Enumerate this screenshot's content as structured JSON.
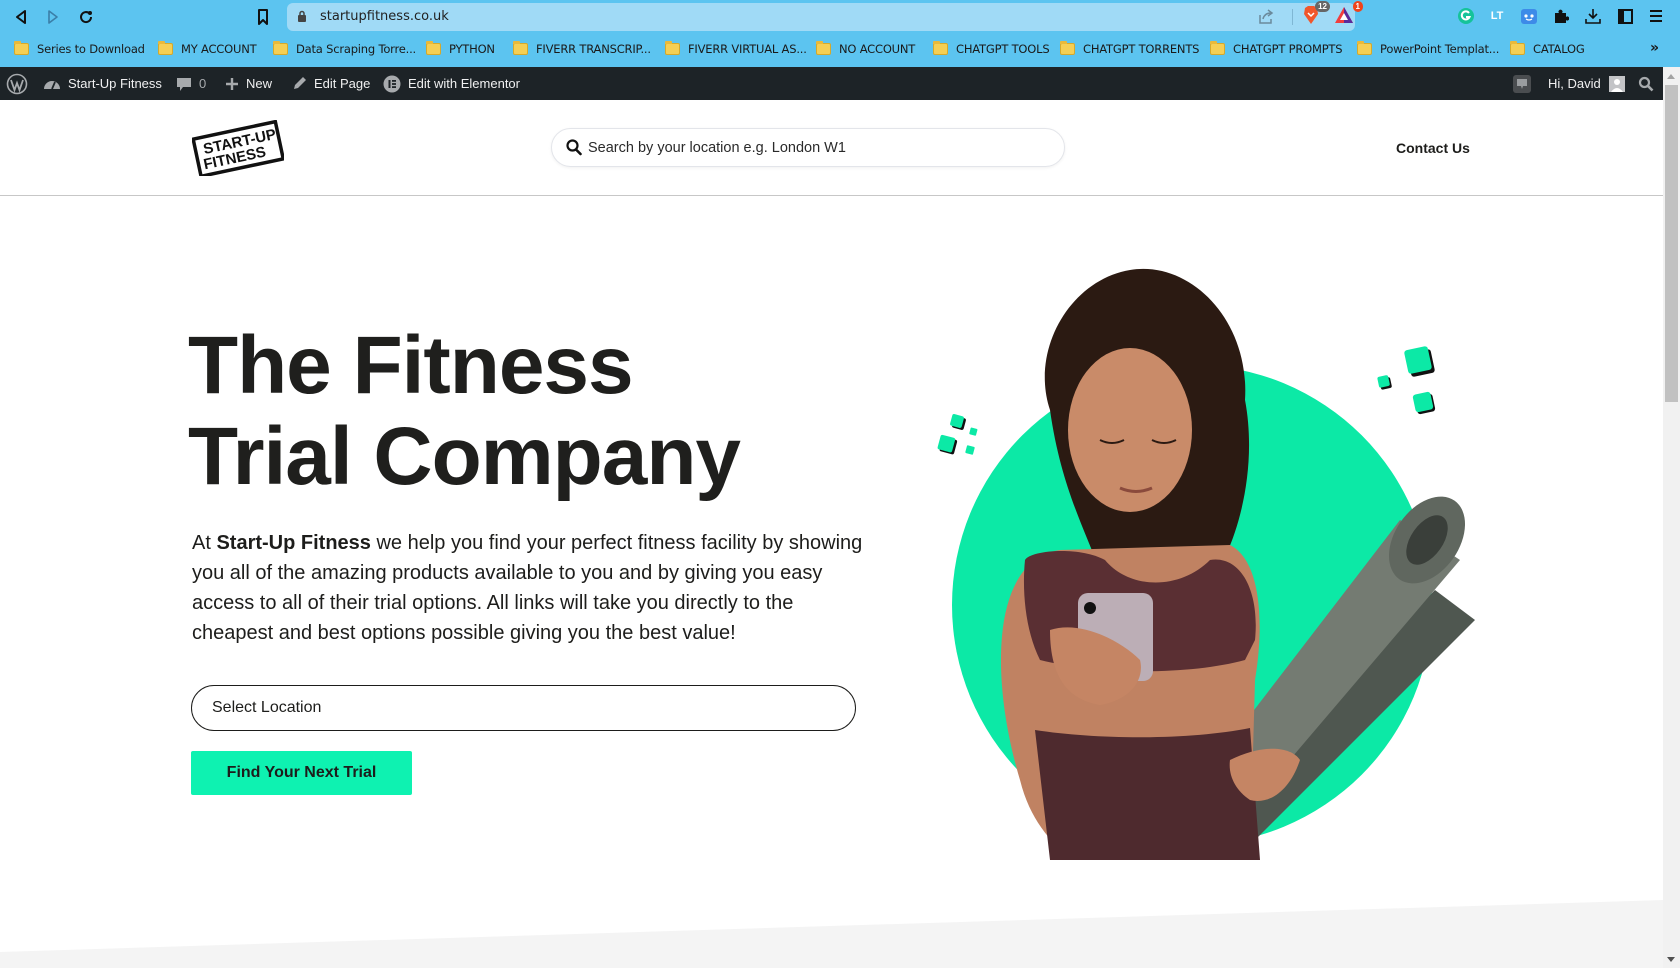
{
  "browser": {
    "url": "startupfitness.co.uk",
    "extensions": {
      "brave_shields_count": "12",
      "brave_rewards_count": "1",
      "lt_label": "LT"
    },
    "bookmarks": [
      "Series to Download",
      "MY ACCOUNT",
      "Data Scraping Torre...",
      "PYTHON",
      "FIVERR TRANSCRIP...",
      "FIVERR VIRTUAL AS...",
      "NO ACCOUNT",
      "CHATGPT TOOLS",
      "CHATGPT TORRENTS",
      "CHATGPT PROMPTS",
      "PowerPoint Templat...",
      "CATALOG"
    ],
    "bookmarks_overflow": "»"
  },
  "admin_bar": {
    "site_name": "Start-Up Fitness",
    "comments_count": "0",
    "new_label": "New",
    "edit_page_label": "Edit Page",
    "elementor_label": "Edit with Elementor",
    "greeting": "Hi, David"
  },
  "header": {
    "logo_line1": "START-UP",
    "logo_line2": "FITNESS",
    "search_placeholder": "Search by your location e.g. London W1",
    "contact_label": "Contact Us"
  },
  "hero": {
    "title_line1": "The Fitness",
    "title_line2": "Trial Company",
    "intro_prefix": "At ",
    "intro_brand": "Start-Up Fitness",
    "intro_rest": " we help you find your perfect fitness facility by showing you all of the amazing products available to you and by giving you easy access to all of their trial options. All links will take you directly to the cheapest and best options possible giving you the best value!",
    "select_label": "Select Location",
    "cta_label": "Find Your Next Trial"
  },
  "colors": {
    "accent": "#0ef2b1",
    "chrome": "#5cc4f0",
    "admin_bar": "#1d2327",
    "text": "#1d1d1b"
  }
}
